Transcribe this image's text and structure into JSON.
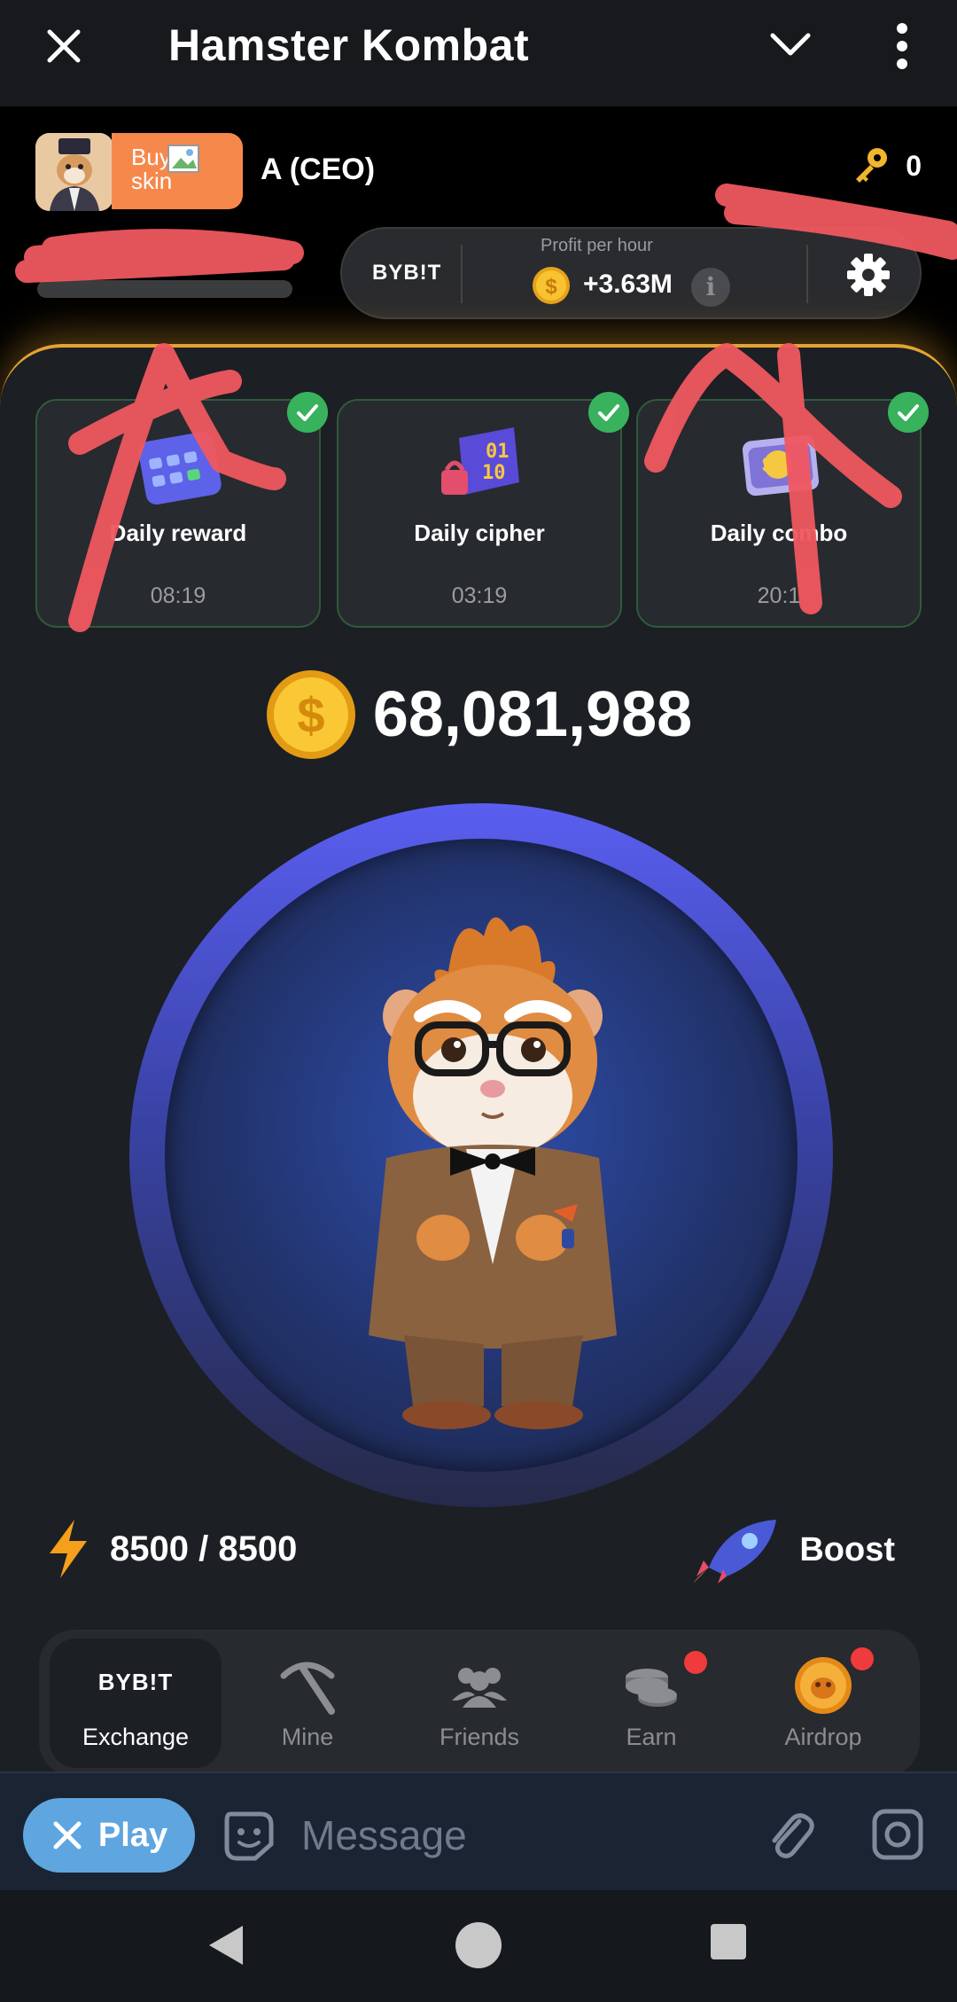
{
  "topbar": {
    "title": "Hamster Kombat",
    "icons": [
      "close-icon",
      "chevron-down-icon",
      "more-vert-icon"
    ]
  },
  "header": {
    "buy_skin_label": "Buy skin",
    "username": "A (CEO)",
    "keys_count": "0"
  },
  "profit": {
    "brand": "BYB!T",
    "label": "Profit per hour",
    "value": "+3.63M",
    "info": "i"
  },
  "daily": [
    {
      "name": "Daily reward",
      "time": "08:19",
      "icon": "calendar-icon",
      "done": true
    },
    {
      "name": "Daily cipher",
      "time": "03:19",
      "icon": "cipher-icon",
      "done": true
    },
    {
      "name": "Daily combo",
      "time": "20:1",
      "icon": "combo-icon",
      "done": true
    }
  ],
  "balance": "68,081,988",
  "energy": "8500 / 8500",
  "boost_label": "Boost",
  "nav": [
    {
      "label": "Exchange",
      "brand": "BYB!T",
      "active": true
    },
    {
      "label": "Mine",
      "active": false
    },
    {
      "label": "Friends",
      "active": false
    },
    {
      "label": "Earn",
      "active": false,
      "badge": true
    },
    {
      "label": "Airdrop",
      "active": false,
      "badge": true
    }
  ],
  "message_bar": {
    "play_label": "Play",
    "placeholder": "Message"
  },
  "colors": {
    "accent_gold": "#e5a332",
    "play_blue": "#5fa6e0",
    "badge_red": "#ef3b3b",
    "check_green": "#38b25d",
    "panel_bg": "#1c1f24"
  }
}
